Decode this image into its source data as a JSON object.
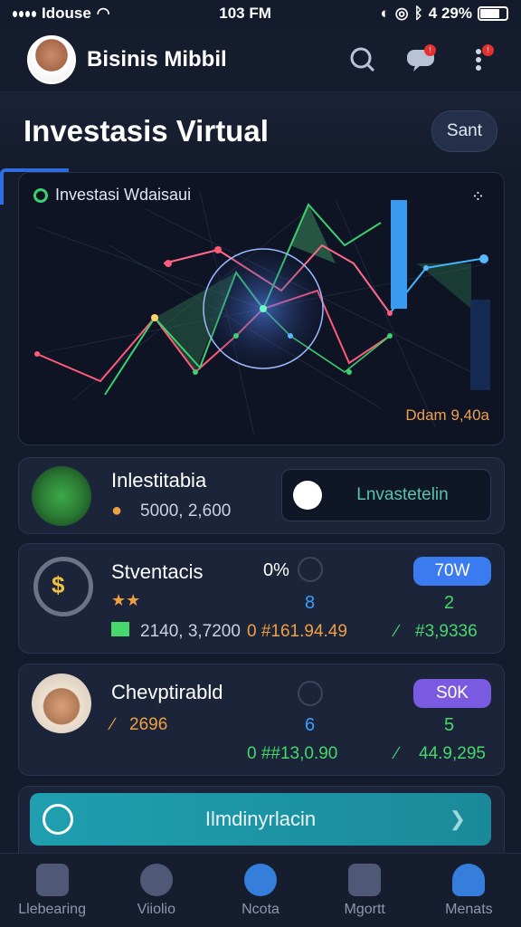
{
  "status": {
    "carrier": "Idouse",
    "time": "103 FM",
    "battery": "4 29%"
  },
  "header": {
    "name": "Bisinis Mibbil"
  },
  "page": {
    "title": "Investasis Virtual",
    "start": "Sant"
  },
  "chart_card": {
    "chip": "Investasi Wdaisaui",
    "corner": "Ddam 9,40a"
  },
  "card1": {
    "title": "Inlestitabia",
    "amount": "5000, 2,600",
    "button": "Lnvastetelin"
  },
  "card2": {
    "title": "Stventacis",
    "pct": "0%",
    "badge": "70W",
    "num1": "8",
    "num2": "2",
    "val1": "2140, 3,7200",
    "val2": "0 #161.94.49",
    "val3": "#3,9336"
  },
  "card3": {
    "title": "Chevptirabld",
    "val0": "2696",
    "badge": "S0K",
    "num1": "6",
    "num2": "5",
    "val2": "0 ##13,0.90",
    "val3": "44.9,295"
  },
  "cta": {
    "label": "Ilmdinyrlacin"
  },
  "nav": [
    {
      "label": "Llebearing"
    },
    {
      "label": "Viiolio"
    },
    {
      "label": "Ncota"
    },
    {
      "label": "Mgortt"
    },
    {
      "label": "Menats"
    }
  ]
}
